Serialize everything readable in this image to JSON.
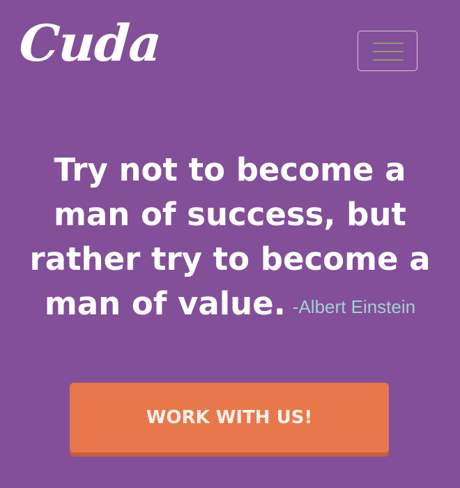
{
  "brand": {
    "logo_text": "Cuda"
  },
  "header": {
    "menu_toggle_icon": "hamburger-menu-icon"
  },
  "hero": {
    "quote_text": "Try not to become a man of success, but rather try to become a man of value.",
    "quote_author": "-Albert Einstein",
    "cta_label": "WORK WITH US!"
  },
  "colors": {
    "background": "#834f98",
    "cta_button": "#e8784c",
    "author_text": "#9fd2d2"
  }
}
